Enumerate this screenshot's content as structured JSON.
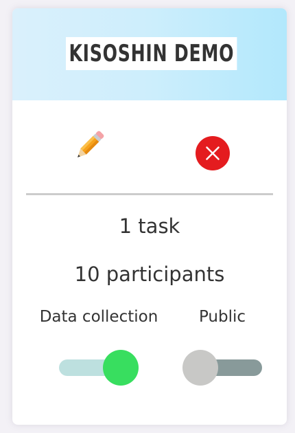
{
  "project": {
    "title": "KISOSHIN DEMO",
    "task_count_text": "1 task",
    "participant_count_text": "10 participants"
  },
  "actions": {
    "edit_icon": "pencil-icon",
    "delete_icon": "close-icon"
  },
  "toggles": {
    "data_collection": {
      "label": "Data collection",
      "state": "on"
    },
    "public": {
      "label": "Public",
      "state": "off"
    }
  },
  "colors": {
    "header_gradient_start": "#daf0fc",
    "header_gradient_end": "#b2e8fc",
    "delete_red": "#e41c1f",
    "toggle_on_knob": "#38de5f",
    "toggle_on_track": "#bde0df",
    "toggle_off_knob": "#c8c8c6",
    "toggle_off_track": "#889a9a",
    "divider": "#cccccc",
    "text": "#333333"
  }
}
